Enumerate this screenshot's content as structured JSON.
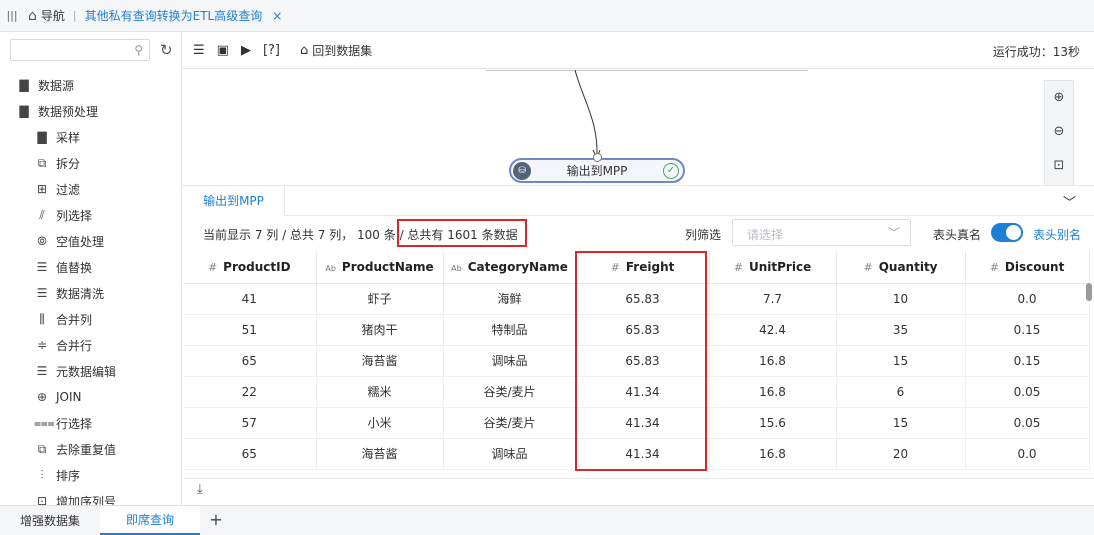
{
  "topbar": {
    "nav_label": "导航",
    "separator": "|",
    "doc_tab": "其他私有查询转换为ETL高级查询",
    "close_glyph": "×"
  },
  "left_panel": {
    "search_placeholder": "",
    "tree": [
      {
        "label": "数据源",
        "icon": "folder-icon",
        "glyph": "▇"
      },
      {
        "label": "数据预处理",
        "icon": "folder-open-icon",
        "glyph": "▇"
      },
      {
        "label": "采样",
        "icon": "sample-icon",
        "glyph": "▇"
      },
      {
        "label": "拆分",
        "icon": "split-icon",
        "glyph": "⧉"
      },
      {
        "label": "过滤",
        "icon": "filter-icon",
        "glyph": "⊞"
      },
      {
        "label": "列选择",
        "icon": "column-select-icon",
        "glyph": "⫽"
      },
      {
        "label": "空值处理",
        "icon": "null-handle-icon",
        "glyph": "⦾"
      },
      {
        "label": "值替换",
        "icon": "value-replace-icon",
        "glyph": "☰"
      },
      {
        "label": "数据清洗",
        "icon": "data-clean-icon",
        "glyph": "☰"
      },
      {
        "label": "合并列",
        "icon": "merge-column-icon",
        "glyph": "⫼"
      },
      {
        "label": "合并行",
        "icon": "merge-row-icon",
        "glyph": "≑"
      },
      {
        "label": "元数据编辑",
        "icon": "metadata-edit-icon",
        "glyph": "☰"
      },
      {
        "label": "JOIN",
        "icon": "join-icon",
        "glyph": "⊕"
      },
      {
        "label": "行选择",
        "icon": "row-select-icon",
        "glyph": "⩶"
      },
      {
        "label": "去除重复值",
        "icon": "dedupe-icon",
        "glyph": "⧉"
      },
      {
        "label": "排序",
        "icon": "sort-icon",
        "glyph": "⫶"
      },
      {
        "label": "增加序列号",
        "icon": "add-serial-icon",
        "glyph": "⊡"
      }
    ]
  },
  "toolbar": {
    "help_label": "[?]",
    "back_label": "回到数据集",
    "run_status": "运行成功：13秒"
  },
  "canvas": {
    "node_label": "输出到MPP"
  },
  "result": {
    "tab_label": "输出到MPP",
    "info_prefix": "当前显示 7 列 / 总共 7 列，  100 条 ",
    "info_highlight": "/ 总共有 1601 条数据",
    "column_filter_label": "列筛选",
    "column_filter_placeholder": "请选择",
    "real_name_label": "表头真名",
    "alias_label": "表头别名",
    "toggle_on": true,
    "columns": [
      {
        "type": "#",
        "name": "ProductID"
      },
      {
        "type": "Ab",
        "name": "ProductName"
      },
      {
        "type": "Ab",
        "name": "CategoryName"
      },
      {
        "type": "#",
        "name": "Freight"
      },
      {
        "type": "#",
        "name": "UnitPrice"
      },
      {
        "type": "#",
        "name": "Quantity"
      },
      {
        "type": "#",
        "name": "Discount"
      }
    ],
    "rows": [
      [
        "41",
        "虾子",
        "海鲜",
        "65.83",
        "7.7",
        "10",
        "0.0"
      ],
      [
        "51",
        "猪肉干",
        "特制品",
        "65.83",
        "42.4",
        "35",
        "0.15"
      ],
      [
        "65",
        "海苔酱",
        "调味品",
        "65.83",
        "16.8",
        "15",
        "0.15"
      ],
      [
        "22",
        "糯米",
        "谷类/麦片",
        "41.34",
        "16.8",
        "6",
        "0.05"
      ],
      [
        "57",
        "小米",
        "谷类/麦片",
        "41.34",
        "15.6",
        "15",
        "0.05"
      ],
      [
        "65",
        "海苔酱",
        "调味品",
        "41.34",
        "16.8",
        "20",
        "0.0"
      ]
    ]
  },
  "bottom_tabs": [
    {
      "label": "增强数据集",
      "active": false
    },
    {
      "label": "即席查询",
      "active": true
    }
  ],
  "colors": {
    "accent": "#1e7fd6",
    "highlight_border": "#d6282c",
    "success": "#3daa58",
    "node_border": "#6f87c9"
  }
}
